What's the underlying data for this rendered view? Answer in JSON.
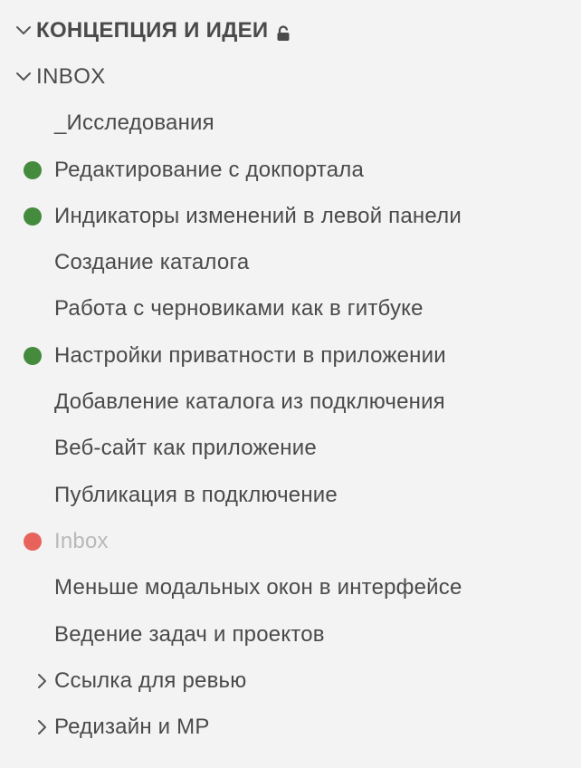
{
  "section": {
    "title": "КОНЦЕПЦИЯ И ИДЕИ",
    "icon": "lock-icon"
  },
  "folder": {
    "title": "INBOX"
  },
  "items": [
    {
      "label": "_Исследования",
      "dot": null,
      "muted": false,
      "collapsed": false
    },
    {
      "label": "Редактирование с докпортала",
      "dot": "#448b3e",
      "muted": false,
      "collapsed": false
    },
    {
      "label": "Индикаторы изменений в левой панели",
      "dot": "#448b3e",
      "muted": false,
      "collapsed": false
    },
    {
      "label": "Создание каталога",
      "dot": null,
      "muted": false,
      "collapsed": false
    },
    {
      "label": "Работа с черновиками как в гитбуке",
      "dot": null,
      "muted": false,
      "collapsed": false
    },
    {
      "label": "Настройки приватности в приложении",
      "dot": "#448b3e",
      "muted": false,
      "collapsed": false
    },
    {
      "label": "Добавление каталога из подключения",
      "dot": null,
      "muted": false,
      "collapsed": false
    },
    {
      "label": "Веб-сайт как приложение",
      "dot": null,
      "muted": false,
      "collapsed": false
    },
    {
      "label": "Публикация в подключение",
      "dot": null,
      "muted": false,
      "collapsed": false
    },
    {
      "label": "Inbox",
      "dot": "#e8625c",
      "muted": true,
      "collapsed": false
    },
    {
      "label": "Меньше модальных окон в интерфейсе",
      "dot": null,
      "muted": false,
      "collapsed": false
    },
    {
      "label": "Ведение задач и проектов",
      "dot": null,
      "muted": false,
      "collapsed": false
    },
    {
      "label": "Ссылка для ревью",
      "dot": null,
      "muted": false,
      "collapsed": true
    },
    {
      "label": "Редизайн и МР",
      "dot": null,
      "muted": false,
      "collapsed": true
    }
  ]
}
